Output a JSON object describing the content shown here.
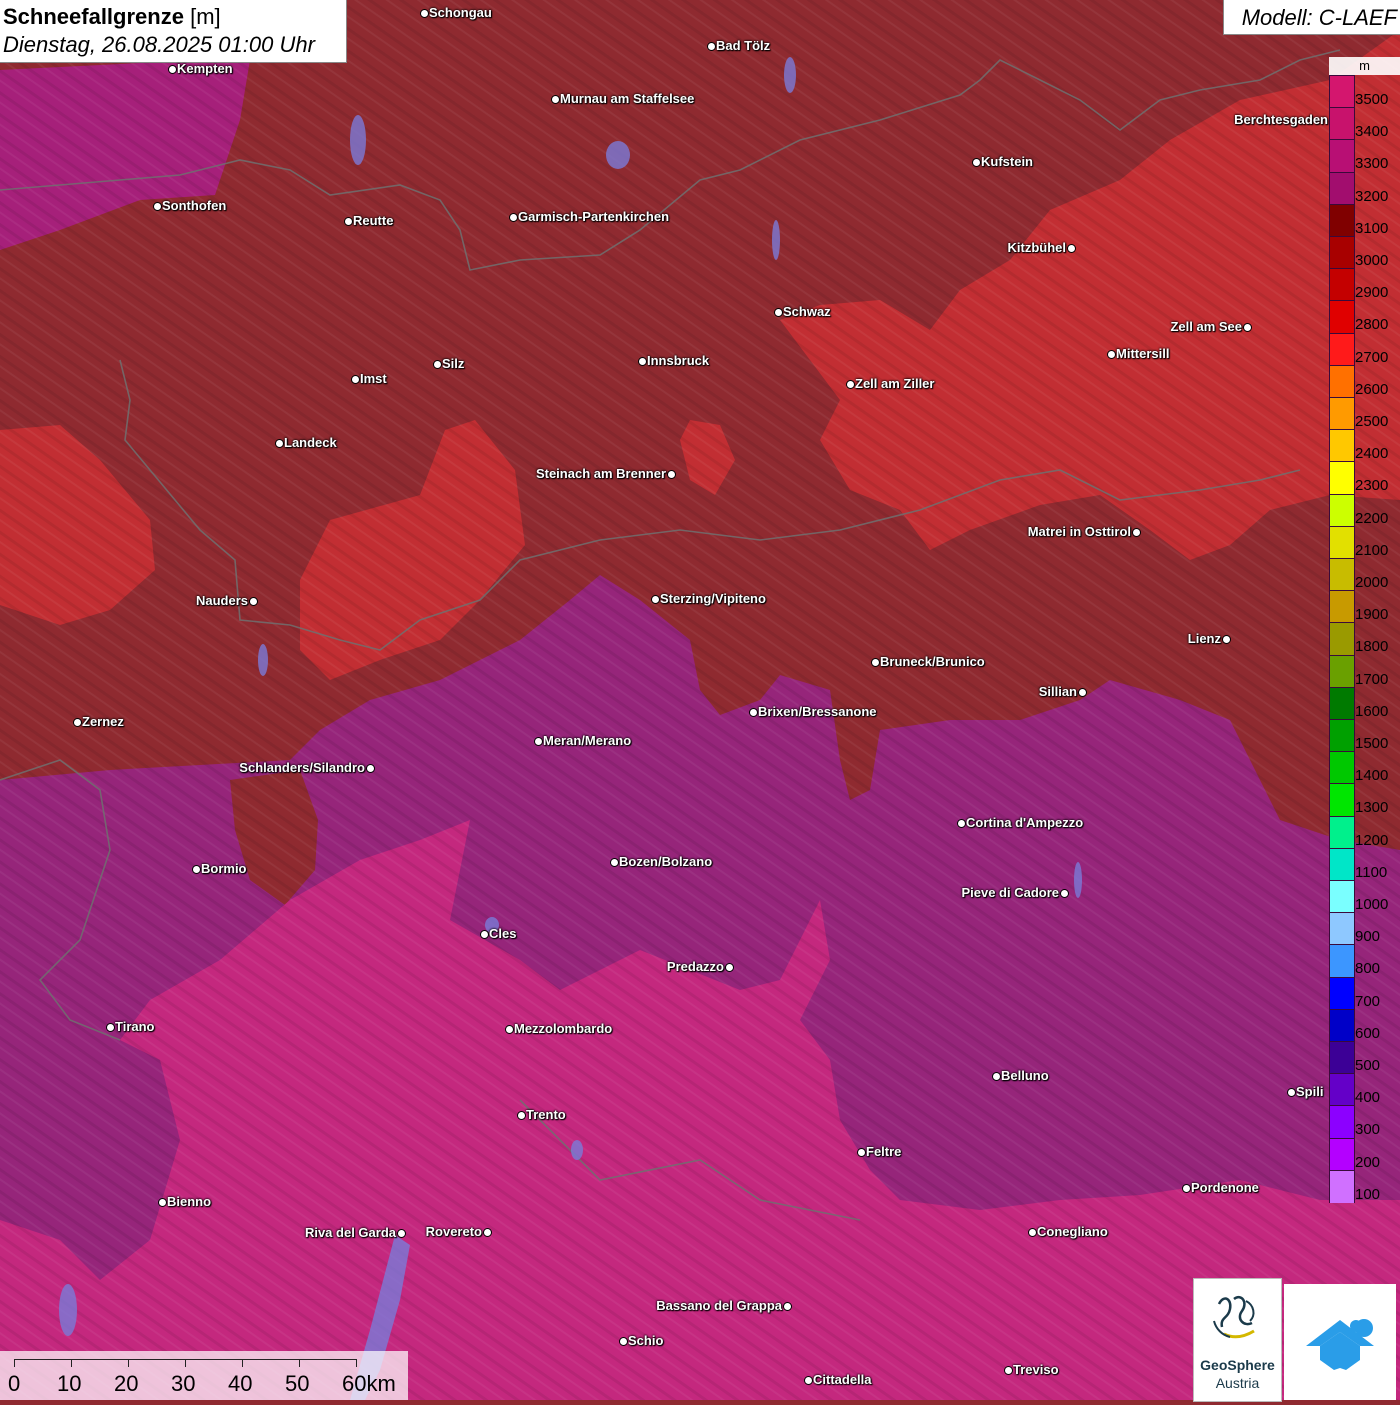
{
  "title": {
    "main": "Schneefallgrenze",
    "unit": "[m]",
    "datetime": "Dienstag, 26.08.2025 01:00 Uhr"
  },
  "model": "Modell: C-LAEF",
  "legend": {
    "unit": "m",
    "items": [
      {
        "value": "3500",
        "color": "#d4166e"
      },
      {
        "value": "3400",
        "color": "#c8126c"
      },
      {
        "value": "3300",
        "color": "#b80f74"
      },
      {
        "value": "3200",
        "color": "#a20d6e"
      },
      {
        "value": "3100",
        "color": "#800000"
      },
      {
        "value": "3000",
        "color": "#a80000"
      },
      {
        "value": "2900",
        "color": "#c40000"
      },
      {
        "value": "2800",
        "color": "#e00000"
      },
      {
        "value": "2700",
        "color": "#ff1a1a"
      },
      {
        "value": "2600",
        "color": "#ff7000"
      },
      {
        "value": "2500",
        "color": "#ff9a00"
      },
      {
        "value": "2400",
        "color": "#ffc800"
      },
      {
        "value": "2300",
        "color": "#ffff00"
      },
      {
        "value": "2200",
        "color": "#ccff00"
      },
      {
        "value": "2100",
        "color": "#e2e000"
      },
      {
        "value": "2000",
        "color": "#c8bc00"
      },
      {
        "value": "1900",
        "color": "#c89a00"
      },
      {
        "value": "1800",
        "color": "#9a9a00"
      },
      {
        "value": "1700",
        "color": "#6aa000"
      },
      {
        "value": "1600",
        "color": "#007a00"
      },
      {
        "value": "1500",
        "color": "#00a000"
      },
      {
        "value": "1400",
        "color": "#00c800"
      },
      {
        "value": "1300",
        "color": "#00e600"
      },
      {
        "value": "1200",
        "color": "#00f08c"
      },
      {
        "value": "1100",
        "color": "#00e6c8"
      },
      {
        "value": "1000",
        "color": "#7affff"
      },
      {
        "value": "900",
        "color": "#8ec8ff"
      },
      {
        "value": "800",
        "color": "#3c96ff"
      },
      {
        "value": "700",
        "color": "#0000ff"
      },
      {
        "value": "600",
        "color": "#0000c8"
      },
      {
        "value": "500",
        "color": "#3c0096"
      },
      {
        "value": "400",
        "color": "#6400c8"
      },
      {
        "value": "300",
        "color": "#8c00ff"
      },
      {
        "value": "200",
        "color": "#b400ff"
      },
      {
        "value": "100",
        "color": "#d070ff"
      }
    ]
  },
  "zones": {
    "dark_red": "#8f2a30",
    "red": "#c22e33",
    "purple": "#96257a",
    "magenta": "#c4287e"
  },
  "cities": [
    {
      "name": "Schongau"
    },
    {
      "name": "Bad Tölz"
    },
    {
      "name": "Kempten"
    },
    {
      "name": "Murnau am Staffelsee"
    },
    {
      "name": "Berchtesgaden"
    },
    {
      "name": "Kufstein"
    },
    {
      "name": "Sonthofen"
    },
    {
      "name": "Reutte"
    },
    {
      "name": "Garmisch-Partenkirchen"
    },
    {
      "name": "Kitzbühel"
    },
    {
      "name": "Schwaz"
    },
    {
      "name": "Zell am See"
    },
    {
      "name": "Mittersill"
    },
    {
      "name": "Innsbruck"
    },
    {
      "name": "Imst"
    },
    {
      "name": "Silz"
    },
    {
      "name": "Zell am Ziller"
    },
    {
      "name": "Landeck"
    },
    {
      "name": "Steinach am Brenner"
    },
    {
      "name": "Matrei in Osttirol"
    },
    {
      "name": "Nauders"
    },
    {
      "name": "Sterzing/Vipiteno"
    },
    {
      "name": "Lienz"
    },
    {
      "name": "Bruneck/Brunico"
    },
    {
      "name": "Sillian"
    },
    {
      "name": "Zernez"
    },
    {
      "name": "Brixen/Bressanone"
    },
    {
      "name": "Meran/Merano"
    },
    {
      "name": "Schlanders/Silandro"
    },
    {
      "name": "Cortina d'Ampezzo"
    },
    {
      "name": "Bozen/Bolzano"
    },
    {
      "name": "Bormio"
    },
    {
      "name": "Pieve di Cadore"
    },
    {
      "name": "Cles"
    },
    {
      "name": "Predazzo"
    },
    {
      "name": "Tirano"
    },
    {
      "name": "Mezzolombardo"
    },
    {
      "name": "Belluno"
    },
    {
      "name": "Spili"
    },
    {
      "name": "Trento"
    },
    {
      "name": "Feltre"
    },
    {
      "name": "Pordenone"
    },
    {
      "name": "Bienno"
    },
    {
      "name": "Riva del Garda"
    },
    {
      "name": "Rovereto"
    },
    {
      "name": "Conegliano"
    },
    {
      "name": "Bassano del Grappa"
    },
    {
      "name": "Schio"
    },
    {
      "name": "Treviso"
    },
    {
      "name": "Cittadella"
    }
  ],
  "scale": {
    "labels": [
      "0",
      "10",
      "20",
      "30",
      "40",
      "50",
      "60km"
    ]
  },
  "logos": {
    "geosphere_name": "GeoSphere",
    "geosphere_sub": "Austria"
  }
}
